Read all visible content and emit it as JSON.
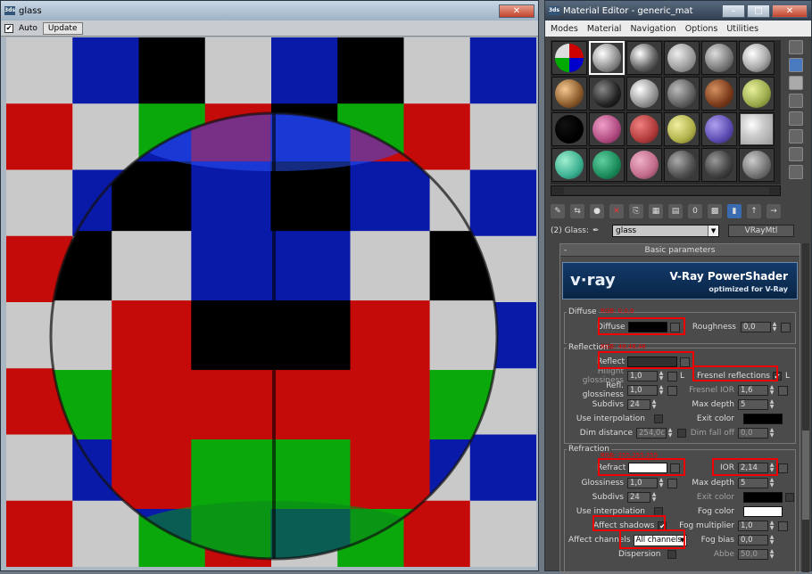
{
  "render_window": {
    "title": "glass",
    "auto_label": "Auto",
    "update_label": "Update",
    "close_glyph": "✕",
    "checker_colors": [
      "#c9c9c9",
      "#c50a0a",
      "#0a1aa8",
      "#0aa80a",
      "#000000"
    ]
  },
  "material_editor": {
    "title": "Material Editor - generic_mat",
    "menu": [
      "Modes",
      "Material",
      "Navigation",
      "Options",
      "Utilities"
    ],
    "name_label": "(2) Glass:",
    "material_name": "glass",
    "material_type": "VRayMtl",
    "rollout_title": "Basic parameters",
    "banner": {
      "logo": "v·ray",
      "title": "V-Ray PowerShader",
      "subtitle": "optimized for V-Ray"
    },
    "diffuse": {
      "group": "Diffuse",
      "diffuse_label": "Diffuse",
      "roughness_label": "Roughness",
      "roughness_value": "0,0",
      "color_note": "RGB: 0,0,0"
    },
    "reflection": {
      "group": "Reflection",
      "reflect_label": "Reflect",
      "color_note": "RGB: 48,48,48",
      "hilight_label": "Hilight glossiness",
      "hilight_value": "1,0",
      "refl_gloss_label": "Refl. glossiness",
      "refl_gloss_value": "1,0",
      "subdivs_label": "Subdivs",
      "subdivs_value": "24",
      "use_interp_label": "Use interpolation",
      "dim_distance_label": "Dim distance",
      "dim_distance_value": "254,0c",
      "fresnel_label": "Fresnel reflections",
      "fresnel_ior_label": "Fresnel IOR",
      "fresnel_ior_value": "1,6",
      "max_depth_label": "Max depth",
      "max_depth_value": "5",
      "exit_color_label": "Exit color",
      "dim_falloff_label": "Dim fall off",
      "dim_falloff_value": "0,0",
      "lock_L": "L"
    },
    "refraction": {
      "group": "Refraction",
      "refract_label": "Refract",
      "color_note": "RGB: 255,255,255",
      "ior_label": "IOR",
      "ior_value": "2,14",
      "glossiness_label": "Glossiness",
      "glossiness_value": "1,0",
      "max_depth_label": "Max depth",
      "max_depth_value": "5",
      "subdivs_label": "Subdivs",
      "subdivs_value": "24",
      "exit_color_label": "Exit color",
      "use_interp_label": "Use interpolation",
      "fog_color_label": "Fog color",
      "affect_shadows_label": "Affect shadows",
      "fog_mult_label": "Fog multiplier",
      "fog_mult_value": "1,0",
      "affect_channels_label": "Affect channels",
      "affect_channels_value": "All channels",
      "fog_bias_label": "Fog bias",
      "fog_bias_value": "0,0",
      "dispersion_label": "Dispersion",
      "abbe_label": "Abbe",
      "abbe_value": "50,0"
    },
    "accent_red": "#e00000"
  }
}
